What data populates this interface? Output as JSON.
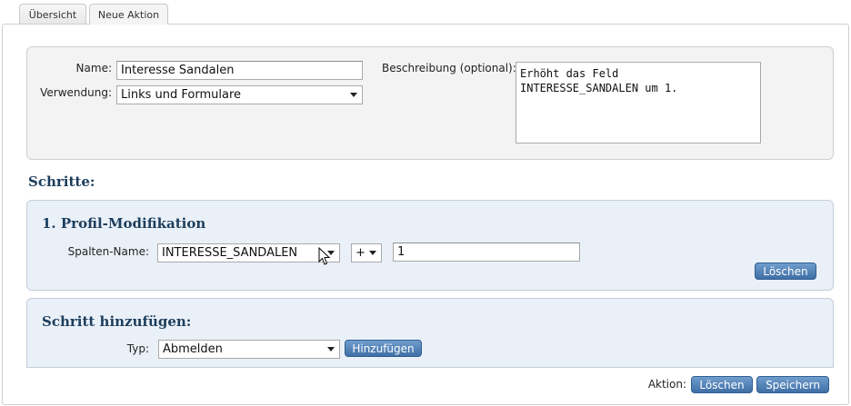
{
  "tabs": [
    {
      "label": "Übersicht",
      "active": false
    },
    {
      "label": "Neue Aktion",
      "active": true
    }
  ],
  "form": {
    "name_label": "Name:",
    "name_value": "Interesse Sandalen",
    "usage_label": "Verwendung:",
    "usage_value": "Links und Formulare",
    "description_label": "Beschreibung (optional):",
    "description_value": "Erhöht das Feld\nINTERESSE_SANDALEN um 1."
  },
  "steps": {
    "heading": "Schritte:",
    "items": [
      {
        "title": "1. Profil-Modifikation",
        "column_label": "Spalten-Name:",
        "column_value": "INTERESSE_SANDALEN",
        "operator_value": "+",
        "amount_value": "1",
        "delete_label": "Löschen"
      }
    ]
  },
  "add_step": {
    "heading": "Schritt hinzufügen:",
    "type_label": "Typ:",
    "type_value": "Abmelden",
    "add_label": "Hinzufügen"
  },
  "footer": {
    "action_label": "Aktion:",
    "delete_label": "Löschen",
    "save_label": "Speichern"
  },
  "colors": {
    "heading": "#1d3e5c",
    "button": "#4a7bb2",
    "panel_blue": "#eaf0f8",
    "panel_grey": "#f3f3f3"
  }
}
